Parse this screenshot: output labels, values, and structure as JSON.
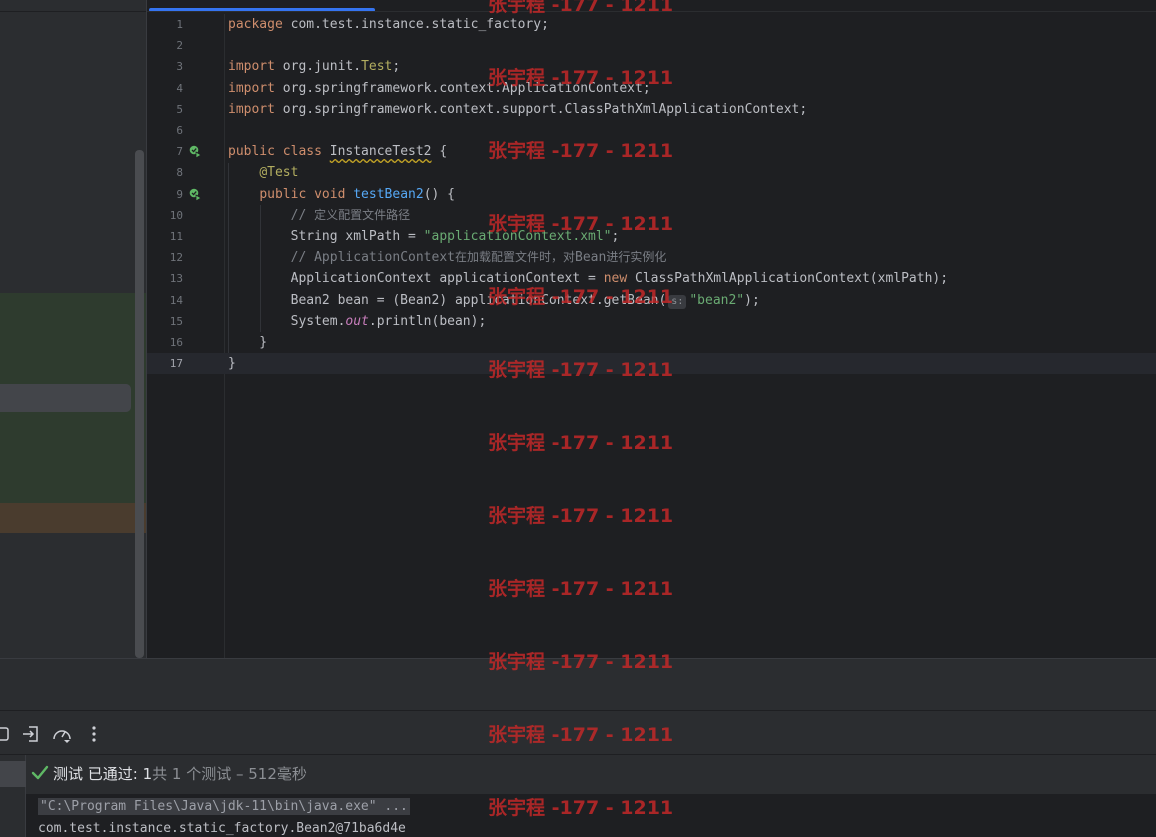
{
  "code_lines": [
    {
      "num": "1",
      "tokens": [
        [
          "kw",
          "package"
        ],
        [
          "p",
          " com.test.instance.static_factory;"
        ]
      ]
    },
    {
      "num": "2",
      "tokens": []
    },
    {
      "num": "3",
      "tokens": [
        [
          "kw",
          "import"
        ],
        [
          "p",
          " org.junit."
        ],
        [
          "ann",
          "Test"
        ],
        [
          "p",
          ";"
        ]
      ]
    },
    {
      "num": "4",
      "tokens": [
        [
          "kw",
          "import"
        ],
        [
          "p",
          " org.springframework.context.ApplicationContext;"
        ]
      ]
    },
    {
      "num": "5",
      "tokens": [
        [
          "kw",
          "import"
        ],
        [
          "p",
          " org.springframework.context.support.ClassPathXmlApplicationContext;"
        ]
      ]
    },
    {
      "num": "6",
      "tokens": []
    },
    {
      "num": "7",
      "run": true,
      "tokens": [
        [
          "kw",
          "public class "
        ],
        [
          "squig",
          "InstanceTest2"
        ],
        [
          "p",
          " {"
        ]
      ]
    },
    {
      "num": "8",
      "tokens": [
        [
          "p",
          "    "
        ],
        [
          "ann",
          "@Test"
        ]
      ]
    },
    {
      "num": "9",
      "run": true,
      "tokens": [
        [
          "p",
          "    "
        ],
        [
          "kw",
          "public void "
        ],
        [
          "fn",
          "testBean2"
        ],
        [
          "p",
          "() {"
        ]
      ]
    },
    {
      "num": "10",
      "tokens": [
        [
          "p",
          "        "
        ],
        [
          "cmt",
          "// "
        ],
        [
          "cmtcjk",
          "定义配置文件路径"
        ]
      ]
    },
    {
      "num": "11",
      "tokens": [
        [
          "p",
          "        String xmlPath = "
        ],
        [
          "str",
          "\"applicationContext.xml\""
        ],
        [
          "p",
          ";"
        ]
      ]
    },
    {
      "num": "12",
      "tokens": [
        [
          "p",
          "        "
        ],
        [
          "cmt",
          "// ApplicationContext"
        ],
        [
          "cmtcjk",
          "在加载配置文件时，对"
        ],
        [
          "cmt",
          "Bean"
        ],
        [
          "cmtcjk",
          "进行实例化"
        ]
      ]
    },
    {
      "num": "13",
      "tokens": [
        [
          "p",
          "        ApplicationContext applicationContext = "
        ],
        [
          "kw",
          "new"
        ],
        [
          "p",
          " ClassPathXmlApplicationContext(xmlPath);"
        ]
      ]
    },
    {
      "num": "14",
      "tokens": [
        [
          "p",
          "        Bean2 bean = (Bean2) applicationContext.getBean("
        ],
        [
          "hint",
          "s:"
        ],
        [
          "str",
          "\"bean2\""
        ],
        [
          "p",
          ");"
        ]
      ]
    },
    {
      "num": "15",
      "tokens": [
        [
          "p",
          "        System."
        ],
        [
          "ital",
          "out"
        ],
        [
          "p",
          ".println(bean);"
        ]
      ]
    },
    {
      "num": "16",
      "tokens": [
        [
          "p",
          "    }"
        ]
      ]
    },
    {
      "num": "17",
      "current": true,
      "tokens": [
        [
          "p",
          "}"
        ]
      ]
    }
  ],
  "test_status": {
    "label": "测试 已通过: ",
    "passed": "1",
    "summary": "共 1 个测试 – 512毫秒"
  },
  "console": {
    "command": "\"C:\\Program Files\\Java\\jdk-11\\bin\\java.exe\" ...",
    "output": "com.test.instance.static_factory.Bean2@71ba6d4e"
  },
  "watermark": {
    "text": "张宇程 -177 - 1211",
    "count": 12
  },
  "icons": {
    "run_gutter": "run-test-icon",
    "toolbar": [
      "stop-icon",
      "import-icon",
      "gauge-icon",
      "more-options-icon"
    ],
    "passed": "check-icon"
  },
  "colors": {
    "accent": "#3574f0",
    "passed": "#5fb865",
    "watermark": "#c82828"
  }
}
